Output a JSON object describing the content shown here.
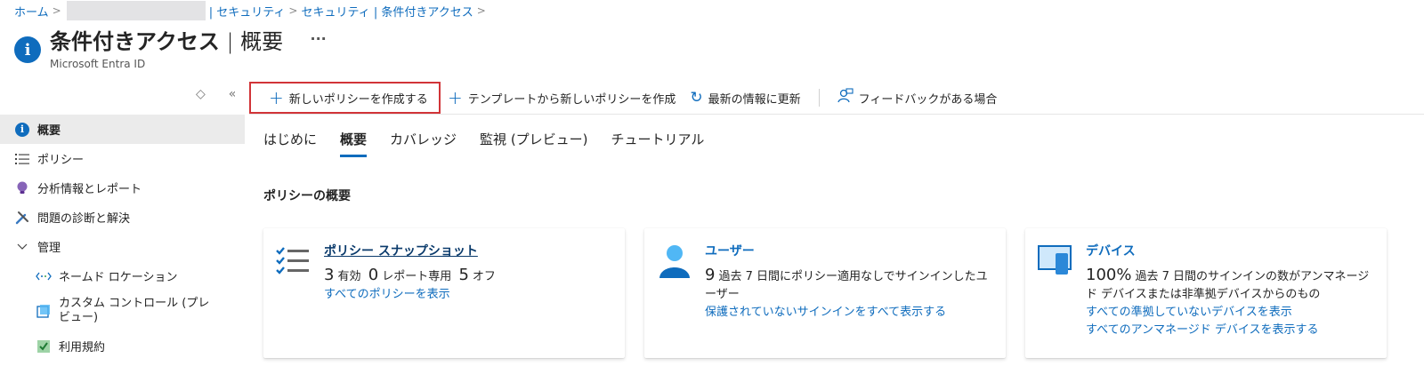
{
  "breadcrumb": {
    "home": "ホーム",
    "security1": "| セキュリティ",
    "security2": "セキュリティ | 条件付きアクセス"
  },
  "header": {
    "title_main": "条件付きアクセス",
    "title_sep": " | ",
    "title_sub": "概要",
    "more": "···",
    "subtitle": "Microsoft Entra ID"
  },
  "sidebar": {
    "items": [
      {
        "label": "概要",
        "icon": "info-icon",
        "active": true
      },
      {
        "label": "ポリシー",
        "icon": "list-icon"
      },
      {
        "label": "分析情報とレポート",
        "icon": "lightbulb-icon"
      },
      {
        "label": "問題の診断と解決",
        "icon": "wrench-icon"
      },
      {
        "label": "管理",
        "icon": "chevron-down-icon"
      },
      {
        "label": "ネームド ロケーション",
        "icon": "named-location-icon"
      },
      {
        "label": "カスタム コントロール (プレビュー)",
        "icon": "custom-control-icon"
      },
      {
        "label": "利用規約",
        "icon": "terms-icon"
      }
    ]
  },
  "toolbar": {
    "new_policy": "新しいポリシーを作成する",
    "from_template": "テンプレートから新しいポリシーを作成",
    "refresh": "最新の情報に更新",
    "feedback": "フィードバックがある場合"
  },
  "tabs": [
    "はじめに",
    "概要",
    "カバレッジ",
    "監視 (プレビュー)",
    "チュートリアル"
  ],
  "section_title": "ポリシーの概要",
  "cards": {
    "policy": {
      "title": "ポリシー スナップショット",
      "enabled_count": "3",
      "enabled_label": "有効",
      "report_count": "0",
      "report_label": "レポート専用",
      "off_count": "5",
      "off_label": "オフ",
      "link": "すべてのポリシーを表示"
    },
    "users": {
      "title": "ユーザー",
      "count": "9",
      "desc": "過去 7 日間にポリシー適用なしでサインインしたユーザー",
      "link": "保護されていないサインインをすべて表示する"
    },
    "devices": {
      "title": "デバイス",
      "percent": "100%",
      "desc": "過去 7 日間のサインインの数がアンマネージド デバイスまたは非準拠デバイスからのもの",
      "link1": "すべての準拠していないデバイスを表示",
      "link2": "すべてのアンマネージド デバイスを表示する"
    }
  },
  "colors": {
    "accent": "#0f6cbd",
    "highlight_border": "#d13438"
  }
}
